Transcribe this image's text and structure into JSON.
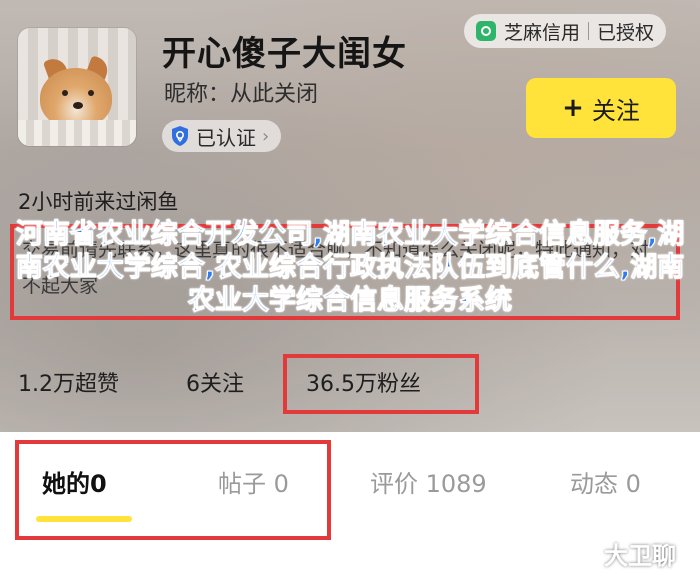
{
  "profile": {
    "title": "开心傻子大闺女",
    "nickname": "昵称：从此关闭",
    "verified_label": "已认证",
    "last_seen": "2小时前来过闲鱼",
    "intro": "交易前请先联系，这里真的很不适合聊，不知道怎么关闭呢，特此通知，对不起大家"
  },
  "sesame": {
    "label": "芝麻信用",
    "status": "已授权"
  },
  "follow_button": {
    "label": "关注"
  },
  "stats": {
    "likes": "1.2万超赞",
    "follows": "6关注",
    "fans": "36.5万粉丝"
  },
  "overlay_text": "河南省农业综合开发公司,湖南农业大学综合信息服务,湖南农业大学综合,农业综合行政执法队伍到底管什么,湖南农业大学综合信息服务系统",
  "tabs": [
    {
      "label": "她的0"
    },
    {
      "label": "帖子 0"
    },
    {
      "label": "评价 1089"
    },
    {
      "label": "动态 0"
    }
  ],
  "watermark": "大卫聊",
  "colors": {
    "accent_yellow": "#ffe23a",
    "highlight_red": "#e23a3a",
    "overlay_blue": "#2f7cf0",
    "sesame_green": "#2fb56a"
  }
}
